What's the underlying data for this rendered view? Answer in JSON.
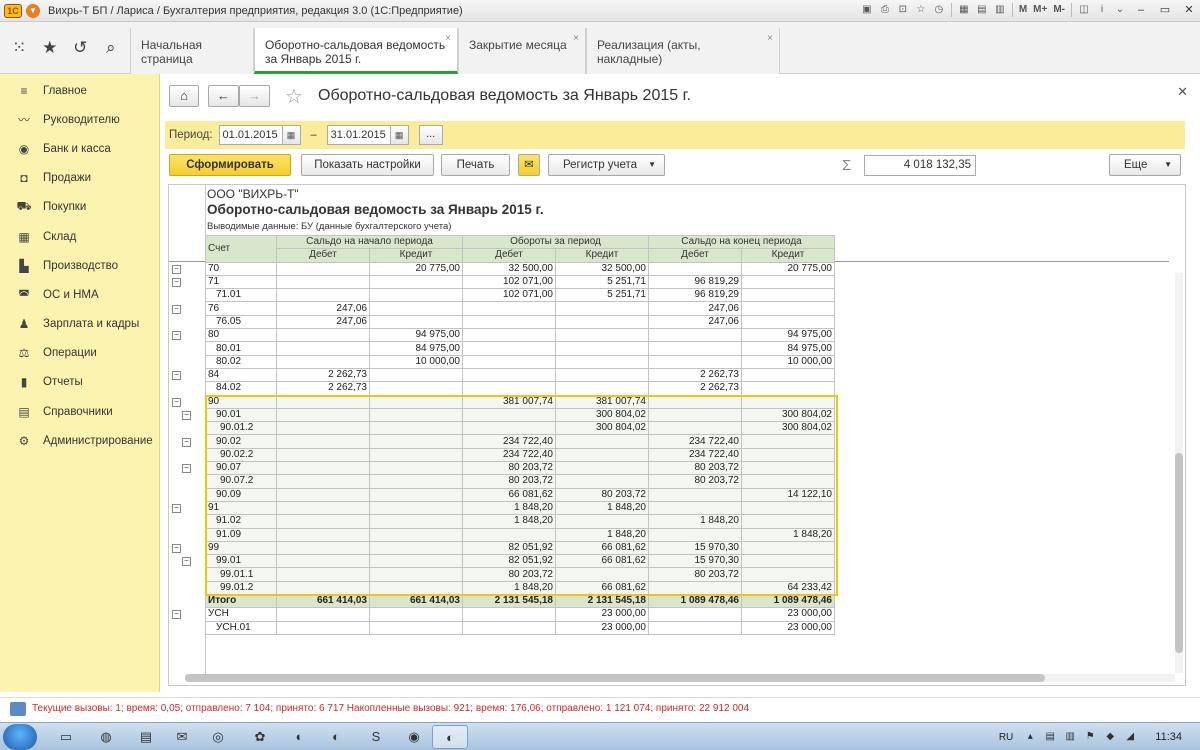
{
  "titlebar": {
    "title": "Вихрь-Т БП / Лариса / Бухгалтерия предприятия, редакция 3.0  (1С:Предприятие)",
    "logo_text": "1С",
    "m_labels": [
      "M",
      "M+",
      "M-"
    ]
  },
  "tabs": [
    {
      "label": "Начальная страница"
    },
    {
      "label": "Оборотно-сальдовая ведомость за Январь 2015 г."
    },
    {
      "label": "Закрытие месяца"
    },
    {
      "label": "Реализация (акты, накладные)"
    }
  ],
  "sidebar": {
    "items": [
      {
        "label": "Главное",
        "icon": "menu-lines-icon"
      },
      {
        "label": "Руководителю",
        "icon": "trend-icon"
      },
      {
        "label": "Банк и касса",
        "icon": "coin-icon"
      },
      {
        "label": "Продажи",
        "icon": "bag-icon"
      },
      {
        "label": "Покупки",
        "icon": "cart-icon"
      },
      {
        "label": "Склад",
        "icon": "warehouse-icon"
      },
      {
        "label": "Производство",
        "icon": "factory-icon"
      },
      {
        "label": "ОС и НМА",
        "icon": "car-icon"
      },
      {
        "label": "Зарплата и кадры",
        "icon": "people-icon"
      },
      {
        "label": "Операции",
        "icon": "scales-icon"
      },
      {
        "label": "Отчеты",
        "icon": "bar-chart-icon"
      },
      {
        "label": "Справочники",
        "icon": "books-icon"
      },
      {
        "label": "Администрирование",
        "icon": "gear-icon"
      }
    ]
  },
  "form": {
    "title": "Оборотно-сальдовая ведомость за Январь 2015 г.",
    "period_label": "Период:",
    "date_from": "01.01.2015",
    "date_to": "31.01.2015",
    "period_dash": "–",
    "dots": "...",
    "buttons": {
      "generate": "Сформировать",
      "settings": "Показать настройки",
      "print": "Печать",
      "register": "Регистр учета",
      "more": "Еще"
    },
    "sum_value": "4 018 132,35"
  },
  "report": {
    "org": "ООО \"ВИХРЬ-Т\"",
    "title": "Оборотно-сальдовая ведомость за Январь 2015 г.",
    "subtitle": "Выводимые данные:  БУ (данные бухгалтерского учета)",
    "headers": {
      "account": "Счет",
      "group1": "Сальдо на начало периода",
      "group2": "Обороты за период",
      "group3": "Сальдо на конец периода",
      "debit": "Дебет",
      "credit": "Кредит"
    },
    "rows": [
      {
        "acc": "70",
        "lvl": 1,
        "v": [
          "",
          "20 775,00",
          "32 500,00",
          "32 500,00",
          "",
          "20 775,00"
        ]
      },
      {
        "acc": "71",
        "lvl": 1,
        "v": [
          "",
          "",
          "102 071,00",
          "5 251,71",
          "96 819,29",
          ""
        ]
      },
      {
        "acc": "71.01",
        "lvl": 2,
        "v": [
          "",
          "",
          "102 071,00",
          "5 251,71",
          "96 819,29",
          ""
        ]
      },
      {
        "acc": "76",
        "lvl": 1,
        "v": [
          "247,06",
          "",
          "",
          "",
          "247,06",
          ""
        ]
      },
      {
        "acc": "76.05",
        "lvl": 2,
        "v": [
          "247,06",
          "",
          "",
          "",
          "247,06",
          ""
        ]
      },
      {
        "acc": "80",
        "lvl": 1,
        "v": [
          "",
          "94 975,00",
          "",
          "",
          "",
          "94 975,00"
        ]
      },
      {
        "acc": "80.01",
        "lvl": 2,
        "v": [
          "",
          "84 975,00",
          "",
          "",
          "",
          "84 975,00"
        ]
      },
      {
        "acc": "80.02",
        "lvl": 2,
        "v": [
          "",
          "10 000,00",
          "",
          "",
          "",
          "10 000,00"
        ]
      },
      {
        "acc": "84",
        "lvl": 1,
        "v": [
          "2 262,73",
          "",
          "",
          "",
          "2 262,73",
          ""
        ]
      },
      {
        "acc": "84.02",
        "lvl": 2,
        "v": [
          "2 262,73",
          "",
          "",
          "",
          "2 262,73",
          ""
        ]
      },
      {
        "acc": "90",
        "lvl": 1,
        "g": true,
        "v": [
          "",
          "",
          "381 007,74",
          "381 007,74",
          "",
          ""
        ]
      },
      {
        "acc": "90.01",
        "lvl": 2,
        "g": true,
        "v": [
          "",
          "",
          "",
          "300 804,02",
          "",
          "300 804,02"
        ]
      },
      {
        "acc": "90.01.2",
        "lvl": 3,
        "g": true,
        "v": [
          "",
          "",
          "",
          "300 804,02",
          "",
          "300 804,02"
        ]
      },
      {
        "acc": "90.02",
        "lvl": 2,
        "g": true,
        "v": [
          "",
          "",
          "234 722,40",
          "",
          "234 722,40",
          ""
        ]
      },
      {
        "acc": "90.02.2",
        "lvl": 3,
        "g": true,
        "v": [
          "",
          "",
          "234 722,40",
          "",
          "234 722,40",
          ""
        ]
      },
      {
        "acc": "90.07",
        "lvl": 2,
        "g": true,
        "v": [
          "",
          "",
          "80 203,72",
          "",
          "80 203,72",
          ""
        ]
      },
      {
        "acc": "90.07.2",
        "lvl": 3,
        "g": true,
        "v": [
          "",
          "",
          "80 203,72",
          "",
          "80 203,72",
          ""
        ]
      },
      {
        "acc": "90.09",
        "lvl": 2,
        "g": true,
        "v": [
          "",
          "",
          "66 081,62",
          "80 203,72",
          "",
          "14 122,10"
        ]
      },
      {
        "acc": "91",
        "lvl": 1,
        "g": true,
        "v": [
          "",
          "",
          "1 848,20",
          "1 848,20",
          "",
          ""
        ]
      },
      {
        "acc": "91.02",
        "lvl": 2,
        "g": true,
        "v": [
          "",
          "",
          "1 848,20",
          "",
          "1 848,20",
          ""
        ]
      },
      {
        "acc": "91.09",
        "lvl": 2,
        "g": true,
        "v": [
          "",
          "",
          "",
          "1 848,20",
          "",
          "1 848,20"
        ]
      },
      {
        "acc": "99",
        "lvl": 1,
        "g": true,
        "v": [
          "",
          "",
          "82 051,92",
          "66 081,62",
          "15 970,30",
          ""
        ]
      },
      {
        "acc": "99.01",
        "lvl": 2,
        "g": true,
        "v": [
          "",
          "",
          "82 051,92",
          "66 081,62",
          "15 970,30",
          ""
        ]
      },
      {
        "acc": "99.01.1",
        "lvl": 3,
        "g": true,
        "v": [
          "",
          "",
          "80 203,72",
          "",
          "80 203,72",
          ""
        ]
      },
      {
        "acc": "99.01.2",
        "lvl": 3,
        "g": true,
        "v": [
          "",
          "",
          "1 848,20",
          "66 081,62",
          "",
          "64 233,42"
        ]
      }
    ],
    "total": {
      "acc": "Итого",
      "v": [
        "661 414,03",
        "661 414,03",
        "2 131 545,18",
        "2 131 545,18",
        "1 089 478,46",
        "1 089 478,46"
      ]
    },
    "offbalance": [
      {
        "acc": "УСН",
        "lvl": 1,
        "v": [
          "",
          "",
          "",
          "23 000,00",
          "",
          "23 000,00"
        ]
      },
      {
        "acc": "УСН.01",
        "lvl": 2,
        "v": [
          "",
          "",
          "",
          "23 000,00",
          "",
          "23 000,00"
        ]
      }
    ]
  },
  "status": {
    "text": "Текущие вызовы: 1; время: 0,05; отправлено: 7 104; принято: 6 717   Накопленные вызовы: 921; время: 176,06; отправлено: 1 121 074; принято: 22 912 004"
  },
  "taskbar": {
    "lang": "RU",
    "clock": "11:34"
  }
}
